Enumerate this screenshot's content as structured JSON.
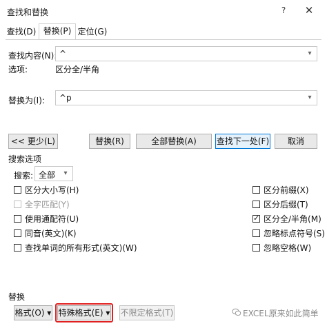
{
  "window": {
    "title": "查找和替换",
    "help_glyph": "?",
    "close_glyph": "✕"
  },
  "tabs": [
    {
      "label": "查找(D)"
    },
    {
      "label": "替换(P)"
    },
    {
      "label": "定位(G)"
    }
  ],
  "find": {
    "label": "查找内容(N):",
    "value": "^"
  },
  "options_line": {
    "label": "选项:",
    "value": "区分全/半角"
  },
  "replace": {
    "label": "替换为(I):",
    "value": "^p"
  },
  "buttons": {
    "less": "<< 更少(L)",
    "replace": "替换(R)",
    "replace_all": "全部替换(A)",
    "find_next": "查找下一处(F)",
    "cancel": "取消"
  },
  "search_options": {
    "heading": "搜索选项",
    "search_label": "搜索:",
    "search_value": "全部",
    "left": [
      {
        "label": "区分大小写(H)",
        "checked": false,
        "disabled": false
      },
      {
        "label": "全字匹配(Y)",
        "checked": false,
        "disabled": true
      },
      {
        "label": "使用通配符(U)",
        "checked": false,
        "disabled": false
      },
      {
        "label": "同音(英文)(K)",
        "checked": false,
        "disabled": false
      },
      {
        "label": "查找单词的所有形式(英文)(W)",
        "checked": false,
        "disabled": false
      }
    ],
    "right": [
      {
        "label": "区分前缀(X)",
        "checked": false,
        "disabled": false
      },
      {
        "label": "区分后缀(T)",
        "checked": false,
        "disabled": false
      },
      {
        "label": "区分全/半角(M)",
        "checked": true,
        "disabled": false
      },
      {
        "label": "忽略标点符号(S)",
        "checked": false,
        "disabled": false
      },
      {
        "label": "忽略空格(W)",
        "checked": false,
        "disabled": false
      }
    ]
  },
  "replace_section": {
    "heading": "替换",
    "format": "格式(O) ▾",
    "special": "特殊格式(E) ▾",
    "no_format": "不限定格式(T)"
  },
  "watermark": {
    "text": "EXCEL原来如此简单"
  },
  "colors": {
    "highlight_box": "#e02020",
    "focus_border": "#0078d7"
  }
}
